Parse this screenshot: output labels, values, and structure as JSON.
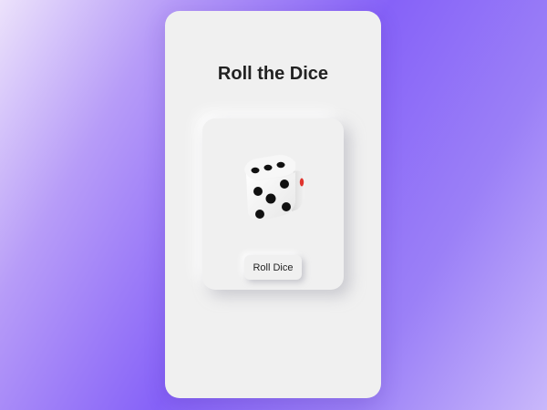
{
  "app": {
    "title": "Roll the Dice"
  },
  "dice": {
    "icon": "dice-icon",
    "top_face_value": 3,
    "front_face_value": 5,
    "side_pip_color": "#e0342e"
  },
  "controls": {
    "roll_label": "Roll Dice"
  },
  "colors": {
    "surface": "#f0f0f0",
    "text": "#222222",
    "accent_gradient_mid": "#8662f8"
  }
}
